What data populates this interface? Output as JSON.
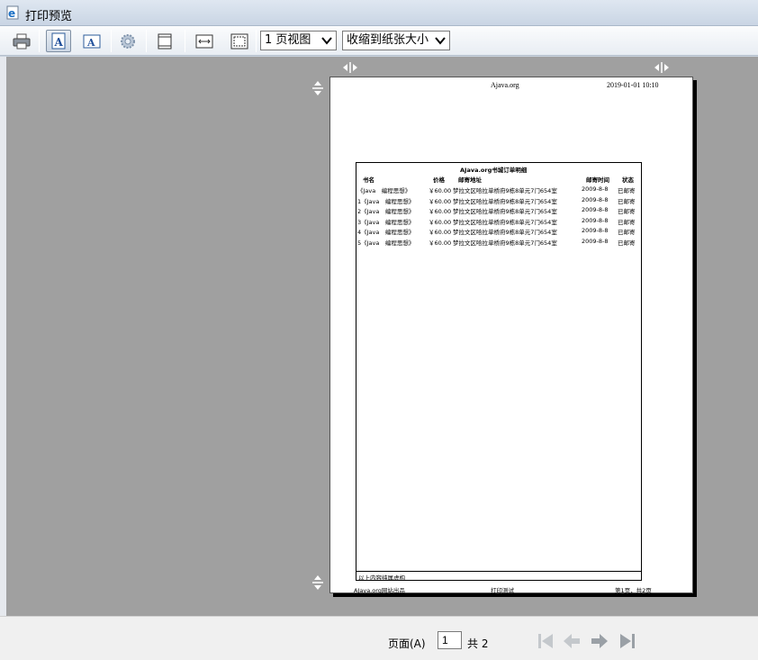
{
  "window": {
    "title": "打印预览"
  },
  "toolbar": {
    "view_select": "1 页视图",
    "fit_select": "收缩到纸张大小"
  },
  "page": {
    "header_center": "Ajava.org",
    "header_right": "2019-01-01 10:10",
    "report_title": "AJava.org书城订单明细",
    "columns": [
      "书名",
      "价格",
      "邮寄地址",
      "邮寄时间",
      "状态"
    ],
    "rows": [
      [
        "《Java　编程思想》",
        "￥60.00",
        "梦拉文区哈拉单桥府9栋8单元7门654室",
        "2009-8-8",
        "已邮寄"
      ],
      [
        "1《Java　编程思想》",
        "￥60.00",
        "梦拉文区哈拉单桥府9栋8单元7门654室",
        "2009-8-8",
        "已邮寄"
      ],
      [
        "2《Java　编程思想》",
        "￥60.00",
        "梦拉文区哈拉单桥府9栋8单元7门654室",
        "2009-8-8",
        "已邮寄"
      ],
      [
        "3《Java　编程思想》",
        "￥60.00",
        "梦拉文区哈拉单桥府9栋8单元7门654室",
        "2009-8-8",
        "已邮寄"
      ],
      [
        "4《Java　编程思想》",
        "￥60.00",
        "梦拉文区哈拉单桥府9栋8单元7门654室",
        "2009-8-8",
        "已邮寄"
      ],
      [
        "5《Java　编程思想》",
        "￥60.00",
        "梦拉文区哈拉单桥府9栋8单元7门654室",
        "2009-8-8",
        "已邮寄"
      ]
    ],
    "table_footer": "以上内容纯属虚构",
    "footer_left": "AJava.org网站出品",
    "footer_center": "打印测试",
    "footer_right": "第1页，共2页"
  },
  "status": {
    "page_label": "页面(A)",
    "current_page": "1",
    "total_label": "共 2"
  }
}
